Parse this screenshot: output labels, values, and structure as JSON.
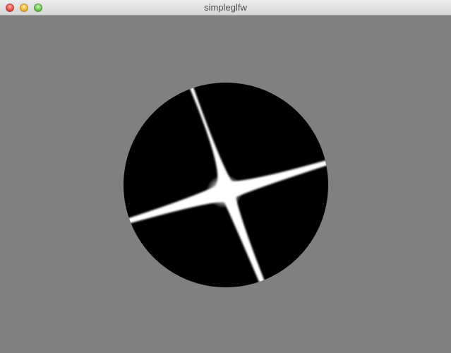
{
  "window": {
    "title": "simpleglfw",
    "controls": [
      {
        "name": "close-button",
        "icon": "close-icon",
        "color": "#e5483f"
      },
      {
        "name": "minimize-button",
        "icon": "minimize-icon",
        "color": "#eeb531"
      },
      {
        "name": "zoom-button",
        "icon": "zoom-icon",
        "color": "#6bc24b"
      }
    ]
  },
  "scene": {
    "background_color": "#808080",
    "disc_color": "#000000",
    "star_color": "#ffffff"
  }
}
